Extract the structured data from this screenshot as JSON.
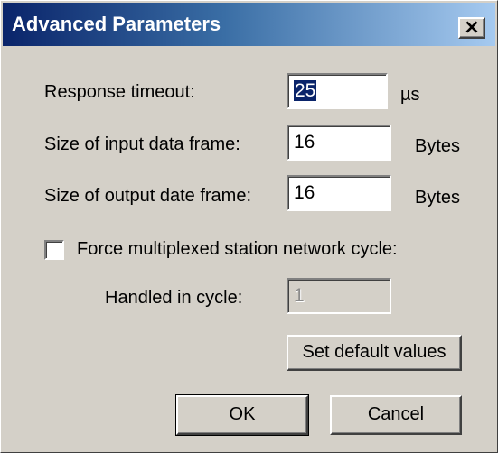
{
  "window": {
    "title": "Advanced Parameters",
    "close_label": "×"
  },
  "fields": {
    "response_timeout": {
      "label": "Response timeout:",
      "value": "25",
      "unit": "µs"
    },
    "input_frame": {
      "label": "Size of input data frame:",
      "value": "16",
      "unit": "Bytes"
    },
    "output_frame": {
      "label": "Size of output date frame:",
      "value": "16",
      "unit": "Bytes"
    }
  },
  "multiplex": {
    "checkbox_label": "Force multiplexed station network cycle:",
    "checked": false,
    "handled_label": "Handled in cycle:",
    "handled_value": "1"
  },
  "buttons": {
    "defaults": "Set default values",
    "ok": "OK",
    "cancel": "Cancel"
  },
  "colors": {
    "titlebar_start": "#0a246a",
    "titlebar_end": "#a6caf0",
    "face": "#d4d0c8"
  }
}
